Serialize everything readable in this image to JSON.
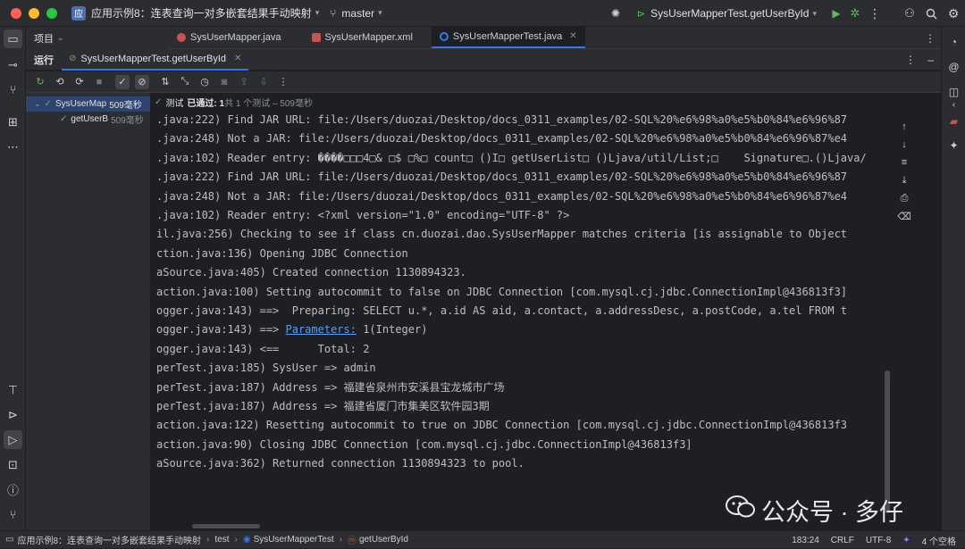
{
  "titlebar": {
    "project_badge": "应",
    "project_name": "应用示例8：连表查询一对多嵌套结果手动映射",
    "branch": "master",
    "run_config": "SysUserMapperTest.getUserById"
  },
  "project_panel": {
    "label": "项目"
  },
  "editor_tabs": [
    {
      "label": "SysUserMapper.java"
    },
    {
      "label": "SysUserMapper.xml"
    },
    {
      "label": "SysUserMapperTest.java"
    }
  ],
  "run": {
    "title": "运行",
    "tab_label": "SysUserMapperTest.getUserById"
  },
  "tree": {
    "root_label": "SysUserMap",
    "root_ms": "509毫秒",
    "child_label": "getUserB",
    "child_ms": "509毫秒"
  },
  "test_status": {
    "prefix": "测试",
    "passed": "已通过: 1",
    "detail": "共 1 个测试 – 509毫秒"
  },
  "console": [
    {
      "text": ".java:222) Find JAR URL: file:/Users/duozai/Desktop/docs_0311_examples/02-SQL%20%e6%98%a0%e5%b0%84%e6%96%87"
    },
    {
      "text": ".java:248) Not a JAR: file:/Users/duozai/Desktop/docs_0311_examples/02-SQL%20%e6%98%a0%e5%b0%84%e6%96%87%e4"
    },
    {
      "text": ".java:102) Reader entry: ����□□□4□& □$ □%□ count□ ()I□ getUserList□ ()Ljava/util/List;□    Signature□.()Ljava/"
    },
    {
      "text": ".java:222) Find JAR URL: file:/Users/duozai/Desktop/docs_0311_examples/02-SQL%20%e6%98%a0%e5%b0%84%e6%96%87"
    },
    {
      "text": ".java:248) Not a JAR: file:/Users/duozai/Desktop/docs_0311_examples/02-SQL%20%e6%98%a0%e5%b0%84%e6%96%87%e4"
    },
    {
      "text": ".java:102) Reader entry: <?xml version=\"1.0\" encoding=\"UTF-8\" ?>"
    },
    {
      "text": "il.java:256) Checking to see if class cn.duozai.dao.SysUserMapper matches criteria [is assignable to Object"
    },
    {
      "text": "ction.java:136) Opening JDBC Connection"
    },
    {
      "text": "aSource.java:405) Created connection 1130894323."
    },
    {
      "text": "action.java:100) Setting autocommit to false on JDBC Connection [com.mysql.cj.jdbc.ConnectionImpl@436813f3]"
    },
    {
      "text": "ogger.java:143) ==>  Preparing: SELECT u.*, a.id AS aid, a.contact, a.addressDesc, a.postCode, a.tel FROM t"
    },
    {
      "pre": "ogger.java:143) ==> ",
      "link": "Parameters:",
      "post": " 1(Integer)"
    },
    {
      "text": "ogger.java:143) <==      Total: 2"
    },
    {
      "text": "perTest.java:185) SysUser => admin"
    },
    {
      "text": "perTest.java:187) Address => 福建省泉州市安溪县宝龙城市广场"
    },
    {
      "text": "perTest.java:187) Address => 福建省厦门市集美区软件园3期"
    },
    {
      "text": "action.java:122) Resetting autocommit to true on JDBC Connection [com.mysql.cj.jdbc.ConnectionImpl@436813f3"
    },
    {
      "text": "action.java:90) Closing JDBC Connection [com.mysql.cj.jdbc.ConnectionImpl@436813f3]"
    },
    {
      "text": "aSource.java:362) Returned connection 1130894323 to pool."
    }
  ],
  "statusbar": {
    "crumbs": [
      "应用示例8：连表查询一对多嵌套结果手动映射",
      "test",
      "SysUserMapperTest",
      "getUserById"
    ],
    "position": "183:24",
    "line_sep": "CRLF",
    "encoding": "UTF-8",
    "indent": "4 个空格"
  },
  "watermark": {
    "text": "公众号 · 多仔"
  },
  "colors": {
    "accent": "#3574f0",
    "pass": "#5fb865",
    "link": "#589df6",
    "bg": "#1e1f22",
    "panel": "#2b2d30"
  }
}
